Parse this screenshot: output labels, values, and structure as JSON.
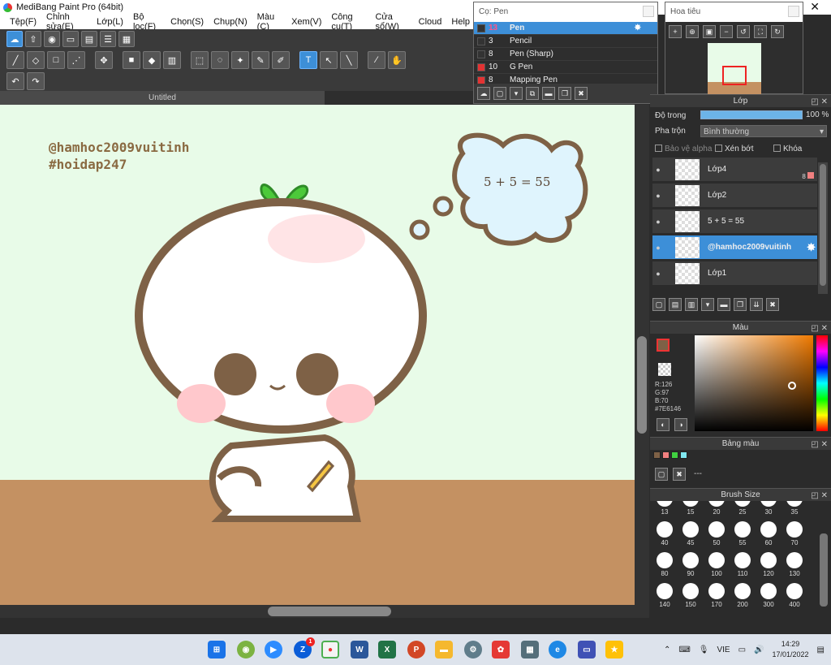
{
  "window": {
    "title": "MediBang Paint Pro (64bit)",
    "close_glyph": "✕"
  },
  "menu": [
    "Tệp(F)",
    "Chỉnh sửa(E)",
    "Lớp(L)",
    "Bộ lọc(F)",
    "Chọn(S)",
    "Chụp(N)",
    "Màu (C)",
    "Xem(V)",
    "Công cụ(T)",
    "Cửa sổ(W)",
    "Cloud",
    "Help"
  ],
  "document": {
    "tab": "Untitled"
  },
  "canvas": {
    "watermark_line1": "@hamhoc2009vuitinh",
    "watermark_line2": "#hoidap247",
    "bubble_text": "5 + 5 = 55",
    "colors": {
      "sky": "#e8fbe8",
      "floor": "#c49162",
      "outline": "#7e6146",
      "leaf": "#4cc93a",
      "bubble": "#dff4fd"
    }
  },
  "brush_panel": {
    "title": "Cọ: Pen",
    "items": [
      {
        "size": "13",
        "name": "Pen",
        "color": "#333333",
        "selected": true
      },
      {
        "size": "3",
        "name": "Pencil",
        "color": "#333333"
      },
      {
        "size": "8",
        "name": "Pen (Sharp)",
        "color": "#333333"
      },
      {
        "size": "10",
        "name": "G Pen",
        "color": "#e33333"
      },
      {
        "size": "8",
        "name": "Mapping Pen",
        "color": "#e33333"
      }
    ]
  },
  "navigator": {
    "title": "Hoa tiêu"
  },
  "layers_panel": {
    "title": "Lớp",
    "opacity_label": "Độ trong",
    "opacity_value": "100 %",
    "opacity_fraction": 1.0,
    "blend_label": "Pha trộn",
    "blend_value": "Bình thường",
    "protect_alpha": "Bảo vệ alpha",
    "clipping": "Xén bớt",
    "lock": "Khóa",
    "badge": "8",
    "layers": [
      {
        "name": "Lớp4"
      },
      {
        "name": "Lớp2"
      },
      {
        "name": "5 + 5 = 55"
      },
      {
        "name": "@hamhoc2009vuitinh",
        "selected": true
      },
      {
        "name": "Lớp1"
      }
    ]
  },
  "color_panel": {
    "title": "Màu",
    "r": "R:126",
    "g": "G:97",
    "b": "B:70",
    "hex": "#7E6146"
  },
  "palette_panel": {
    "title": "Bảng màu",
    "colors": [
      "#7e6146",
      "#f08080",
      "#40d040",
      "#80e8f0"
    ],
    "placeholder": "---"
  },
  "brush_size_panel": {
    "title": "Brush Size",
    "sizes": [
      "13",
      "15",
      "20",
      "25",
      "30",
      "35",
      "40",
      "45",
      "50",
      "55",
      "60",
      "70",
      "80",
      "90",
      "100",
      "110",
      "120",
      "130",
      "140",
      "150",
      "170",
      "200",
      "300",
      "400"
    ]
  },
  "taskbar": {
    "zalo_badge": "1",
    "lang": "VIE",
    "time": "14:29",
    "date": "17/01/2022"
  }
}
